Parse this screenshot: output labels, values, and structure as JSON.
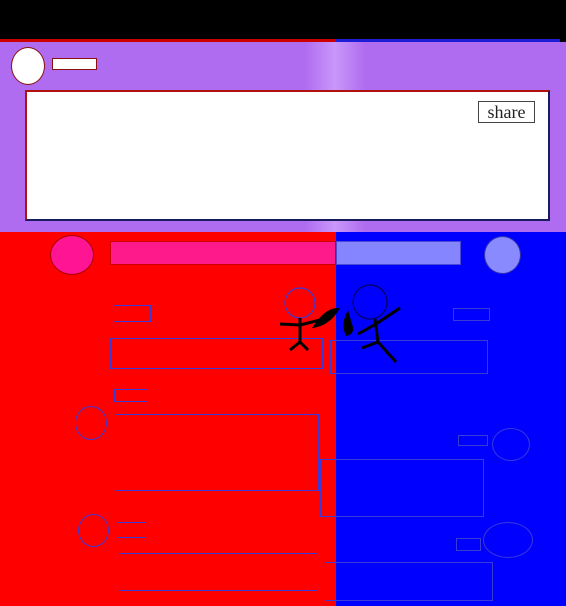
{
  "composer": {
    "share_label": "share"
  },
  "icons": {
    "user_avatar": "avatar-icon",
    "red_avatar": "red-player-avatar-icon",
    "blue_avatar": "blue-player-avatar-icon",
    "fighters": "stick-fighters-icon"
  },
  "colors": {
    "top_bar": "#000000",
    "composer_bg": "#b06cf0",
    "red_side": "#ff0000",
    "blue_side": "#0000ff",
    "red_accent": "#ff1493",
    "blue_accent": "#8585ff"
  },
  "battle": {
    "red_share": 0.63,
    "blue_share": 0.37
  }
}
